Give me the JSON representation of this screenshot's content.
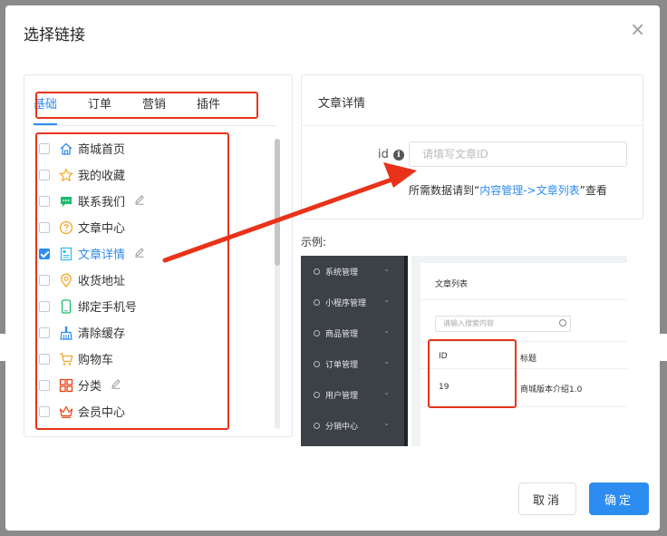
{
  "dialog": {
    "title": "选择链接",
    "close_glyph": "×"
  },
  "tabs": [
    "基础",
    "订单",
    "营销",
    "插件"
  ],
  "links": [
    {
      "label": "商城首页",
      "icon": "home-icon",
      "color": "#2d8cf0",
      "checked": false,
      "editable": false
    },
    {
      "label": "我的收藏",
      "icon": "star-icon",
      "color": "#f5a623",
      "checked": false,
      "editable": false
    },
    {
      "label": "联系我们",
      "icon": "chat-icon",
      "color": "#19be6b",
      "checked": false,
      "editable": true
    },
    {
      "label": "文章中心",
      "icon": "question-icon",
      "color": "#f5a623",
      "checked": false,
      "editable": false
    },
    {
      "label": "文章详情",
      "icon": "article-icon",
      "color": "#2db7f5",
      "checked": true,
      "editable": true
    },
    {
      "label": "收货地址",
      "icon": "location-icon",
      "color": "#f5a623",
      "checked": false,
      "editable": false
    },
    {
      "label": "绑定手机号",
      "icon": "phone-icon",
      "color": "#19be6b",
      "checked": false,
      "editable": false
    },
    {
      "label": "清除缓存",
      "icon": "broom-icon",
      "color": "#2d8cf0",
      "checked": false,
      "editable": false
    },
    {
      "label": "购物车",
      "icon": "cart-icon",
      "color": "#f5a623",
      "checked": false,
      "editable": false
    },
    {
      "label": "分类",
      "icon": "grid-icon",
      "color": "#ed4014",
      "checked": false,
      "editable": true
    },
    {
      "label": "会员中心",
      "icon": "crown-icon",
      "color": "#ed4014",
      "checked": false,
      "editable": false
    }
  ],
  "detail": {
    "title": "文章详情",
    "id_label": "id",
    "id_placeholder": "请填写文章ID",
    "id_value": "",
    "hint_prefix": "所需数据请到“",
    "hint_link": "内容管理->文章列表",
    "hint_suffix": "”查看"
  },
  "example": {
    "label": "示例:",
    "nav": [
      "系统管理",
      "小程序管理",
      "商品管理",
      "订单管理",
      "用户管理",
      "分销中心"
    ],
    "panel_title": "文章列表",
    "search_placeholder": "请输入搜索内容",
    "columns": [
      "ID",
      "标题"
    ],
    "row": [
      "19",
      "商城版本介绍1.0"
    ]
  },
  "buttons": {
    "cancel": "取消",
    "confirm": "确定"
  },
  "colors": {
    "primary": "#2d8cf0",
    "annotation_red": "#e8331a"
  }
}
